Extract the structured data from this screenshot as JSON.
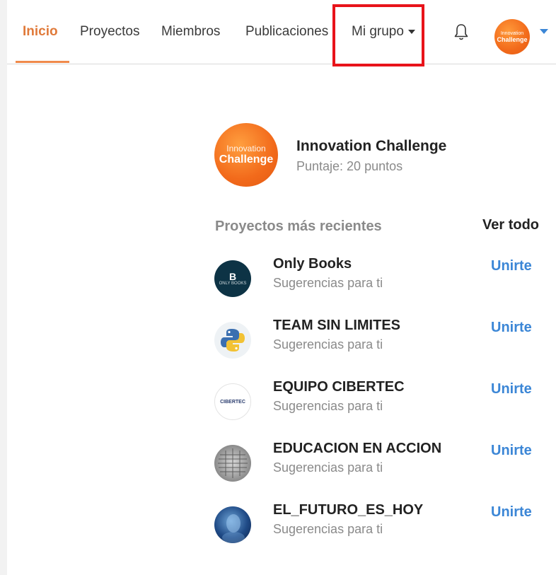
{
  "nav": {
    "items": [
      {
        "label": "Inicio",
        "active": true
      },
      {
        "label": "Proyectos",
        "active": false
      },
      {
        "label": "Miembros",
        "active": false
      },
      {
        "label": "Publicaciones",
        "active": false
      },
      {
        "label": "Mi grupo",
        "active": false,
        "has_dropdown": true
      }
    ],
    "notification_icon": "bell-icon",
    "avatar_text": {
      "line1": "Innovation",
      "line2": "Challenge"
    },
    "highlighted_item": "Mi grupo"
  },
  "profile": {
    "logo_text": {
      "line1": "Innovation",
      "line2": "Challenge"
    },
    "name": "Innovation Challenge",
    "score": "Puntaje: 20 puntos"
  },
  "projects_section": {
    "title": "Proyectos más recientes",
    "see_all": "Ver todo",
    "items": [
      {
        "name": "Only Books",
        "subtitle": "Sugerencias para ti",
        "action": "Unirte",
        "avatar": {
          "icon": "only-books-logo",
          "mark": "B",
          "caption": "ONLY BOOKS"
        }
      },
      {
        "name": "TEAM SIN LIMITES",
        "subtitle": "Sugerencias para ti",
        "action": "Unirte",
        "avatar": {
          "icon": "python-logo"
        }
      },
      {
        "name": "EQUIPO CIBERTEC",
        "subtitle": "Sugerencias para ti",
        "action": "Unirte",
        "avatar": {
          "icon": "cibertec-logo",
          "caption": "CIBERTEC"
        }
      },
      {
        "name": "EDUCACION EN ACCION",
        "subtitle": "Sugerencias para ti",
        "action": "Unirte",
        "avatar": {
          "icon": "education-logo"
        }
      },
      {
        "name": "EL_FUTURO_ES_HOY",
        "subtitle": "Sugerencias para ti",
        "action": "Unirte",
        "avatar": {
          "icon": "futuristic-face-image"
        }
      }
    ]
  },
  "colors": {
    "accent_orange": "#e07a3a",
    "link_blue": "#3b86d6",
    "highlight_red": "#e8131a",
    "muted_text": "#8a8a8a"
  }
}
